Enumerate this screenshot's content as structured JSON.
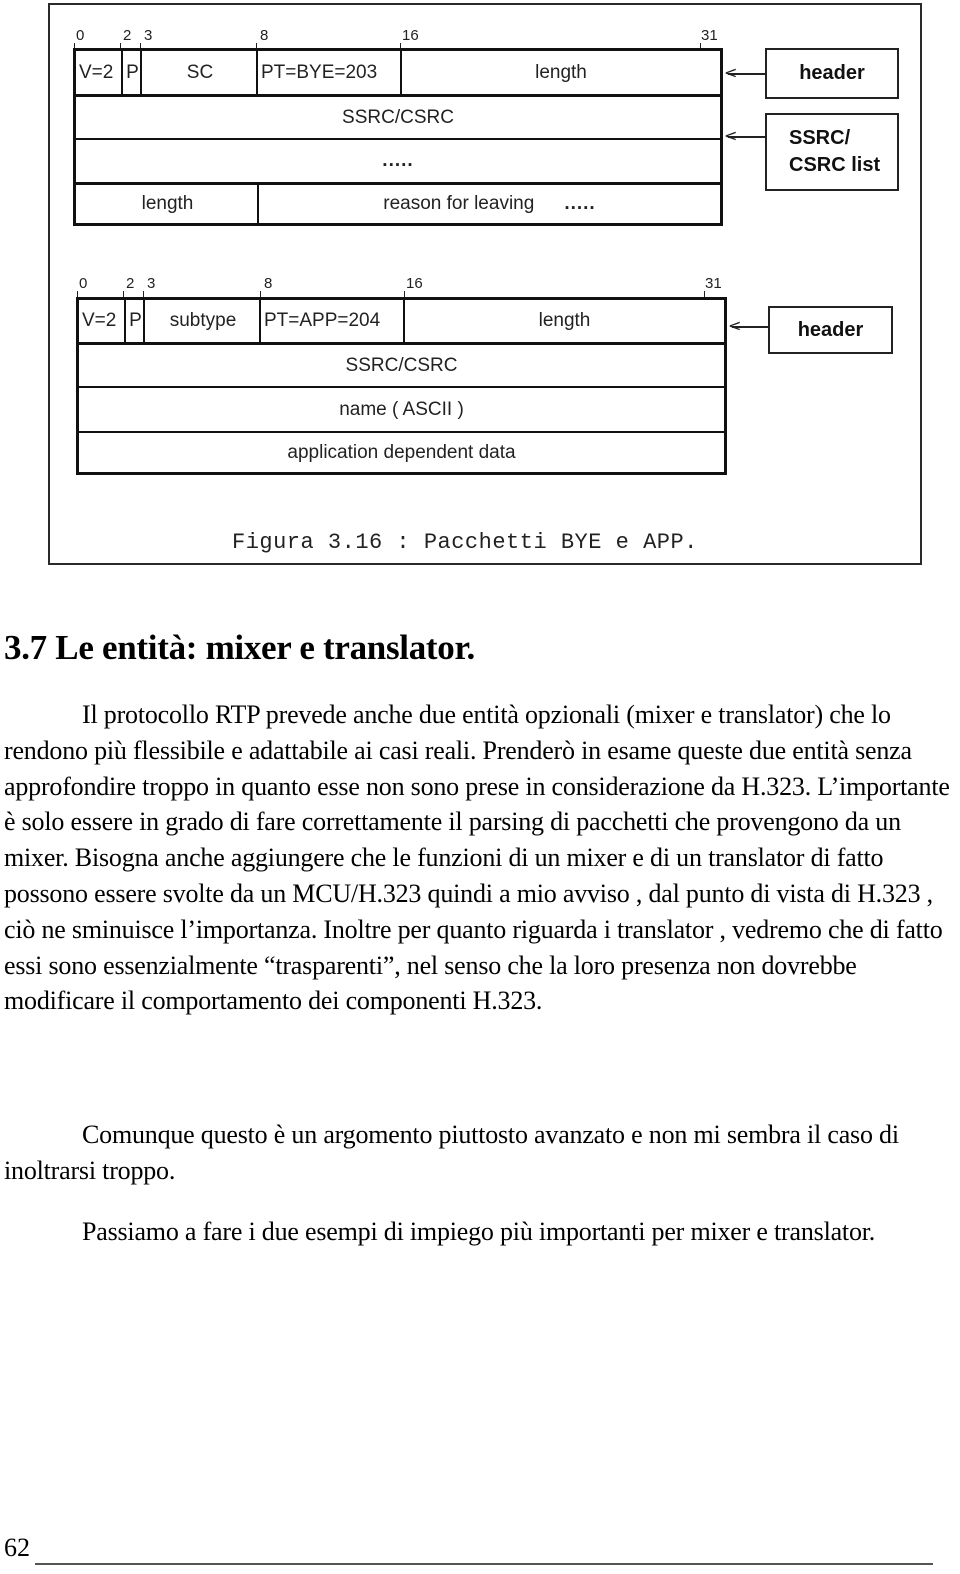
{
  "figure": {
    "caption": "Figura 3.16 : Pacchetti BYE e APP.",
    "bye_packet": {
      "bit_labels": [
        "0",
        "2",
        "3",
        "8",
        "16",
        "31"
      ],
      "row1": {
        "v": "V=2",
        "p": "P",
        "sc": "SC",
        "pt": "PT=BYE=203",
        "length": "length"
      },
      "row2": "SSRC/CSRC",
      "row3": ".....",
      "row4": {
        "length": "length",
        "reason": "reason for leaving",
        "dots": "....."
      },
      "legend": {
        "header": "header",
        "list_line1": "SSRC/",
        "list_line2": "CSRC list"
      }
    },
    "app_packet": {
      "bit_labels": [
        "0",
        "2",
        "3",
        "8",
        "16",
        "31"
      ],
      "row1": {
        "v": "V=2",
        "p": "P",
        "subtype": "subtype",
        "pt": "PT=APP=204",
        "length": "length"
      },
      "row2": "SSRC/CSRC",
      "row3": "name ( ASCII )",
      "row4": "application dependent data",
      "legend": {
        "header": "header"
      }
    },
    "arrow_glyph": "<"
  },
  "section": {
    "heading": "3.7 Le entità: mixer e translator.",
    "paragraphs": [
      "Il protocollo RTP prevede anche due entità opzionali (mixer e translator) che lo rendono più flessibile e adattabile ai casi reali. Prenderò in esame queste due entità senza approfondire troppo in quanto esse non sono prese in considerazione da H.323. L’importante è solo essere in grado di fare correttamente il parsing di pacchetti che provengono da un mixer. Bisogna anche aggiungere che le funzioni di un mixer e di un translator di fatto possono essere svolte da un MCU/H.323 quindi a mio avviso , dal punto di vista di H.323 , ciò ne sminuisce l’importanza. Inoltre per quanto riguarda i translator , vedremo che di fatto essi sono essenzialmente “trasparenti”, nel senso che la loro presenza non dovrebbe modificare il comportamento dei componenti H.323.",
      "Comunque questo è un argomento piuttosto avanzato e non mi sembra il caso di inoltrarsi troppo.",
      "Passiamo a fare i due esempi di impiego più importanti per mixer e translator."
    ]
  },
  "footer": {
    "page_number": "62"
  }
}
